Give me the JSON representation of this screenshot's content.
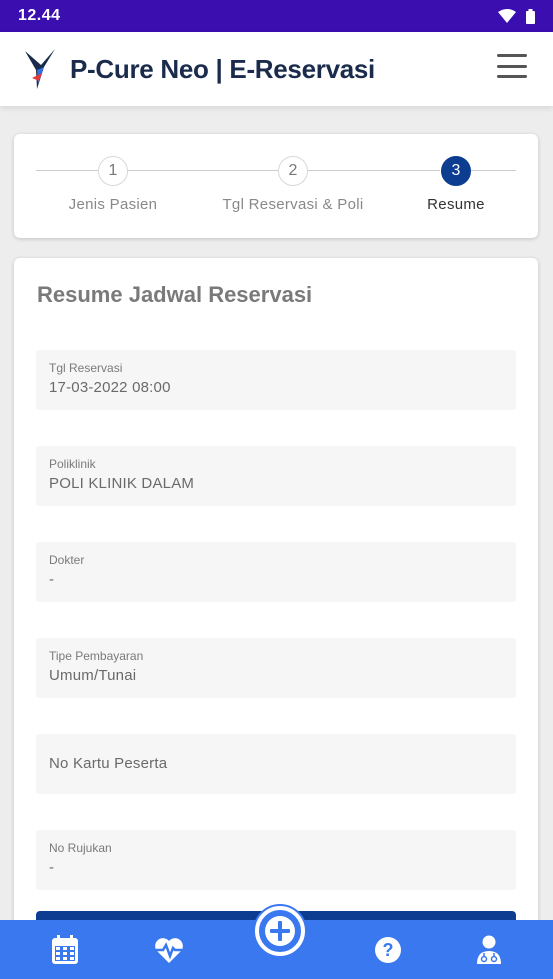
{
  "status_bar": {
    "time": "12.44",
    "icons": [
      "wifi-icon",
      "battery-icon"
    ]
  },
  "header": {
    "title": "P-Cure Neo | E-Reservasi",
    "logo_icon": "pcure-logo",
    "menu_icon": "hamburger-menu-icon"
  },
  "stepper": {
    "steps": [
      {
        "number": "1",
        "label": "Jenis Pasien",
        "active": false
      },
      {
        "number": "2",
        "label": "Tgl Reservasi & Poli",
        "active": false
      },
      {
        "number": "3",
        "label": "Resume",
        "active": true
      }
    ]
  },
  "resume": {
    "title": "Resume Jadwal Reservasi",
    "fields": [
      {
        "label": "Tgl Reservasi",
        "value": "17-03-2022 08:00"
      },
      {
        "label": "Poliklinik",
        "value": "POLI KLINIK DALAM"
      },
      {
        "label": "Dokter",
        "value": "-"
      },
      {
        "label": "Tipe Pembayaran",
        "value": "Umum/Tunai"
      },
      {
        "label": "",
        "value": "",
        "placeholder": "No Kartu Peserta"
      },
      {
        "label": "No Rujukan",
        "value": "-"
      }
    ]
  },
  "bottom_nav": {
    "items": [
      "calendar-icon",
      "heartbeat-icon",
      "add-icon",
      "help-icon",
      "doctor-icon"
    ]
  },
  "colors": {
    "status_bar": "#3b0eb0",
    "primary": "#0d3d91",
    "nav": "#3a78f0"
  }
}
